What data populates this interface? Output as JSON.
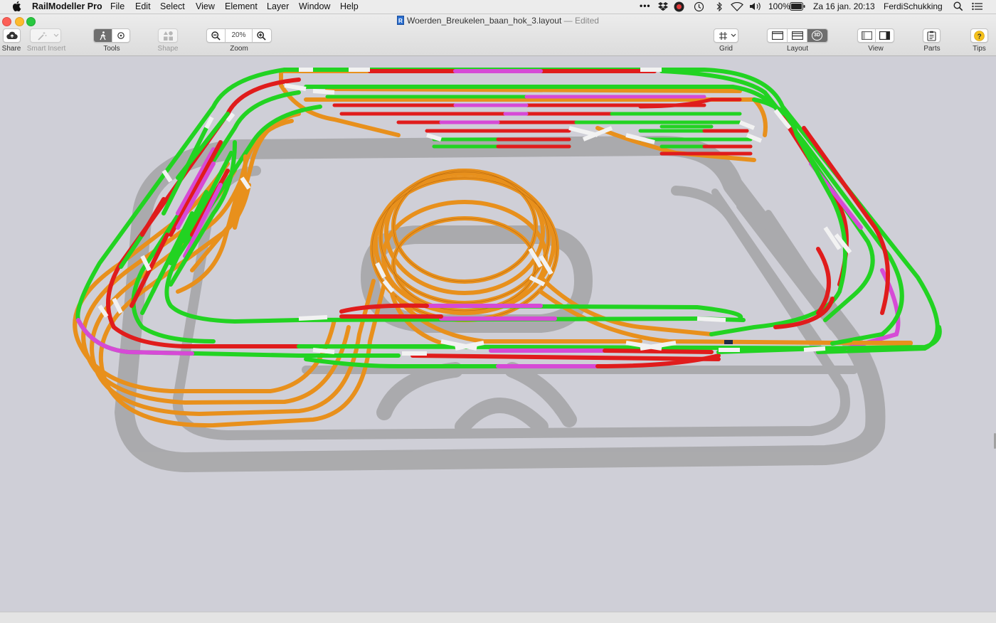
{
  "menubar": {
    "app_name": "RailModeller Pro",
    "menus": [
      "File",
      "Edit",
      "Select",
      "View",
      "Element",
      "Layer",
      "Window",
      "Help"
    ],
    "battery": "100%",
    "datetime": "Za 16 jan.  20:13",
    "user": "FerdiSchukking"
  },
  "window": {
    "title": "Woerden_Breukelen_baan_hok_3.layout",
    "status": "— Edited"
  },
  "toolbar": {
    "share_label": "Share",
    "smart_insert_label": "Smart Insert",
    "tools_label": "Tools",
    "shape_label": "Shape",
    "zoom_label": "Zoom",
    "zoom_value": "20%",
    "grid_label": "Grid",
    "layout_label": "Layout",
    "view_label": "View",
    "parts_label": "Parts",
    "tips_label": "Tips",
    "layout_3d_badge": "3D"
  },
  "colors": {
    "track_orange": "#e8901c",
    "track_green": "#22d322",
    "track_red": "#e01c1c",
    "track_magenta": "#d64ad6",
    "track_shadow": "#a9a9ab",
    "canvas_bg": "#cfcfd7"
  }
}
